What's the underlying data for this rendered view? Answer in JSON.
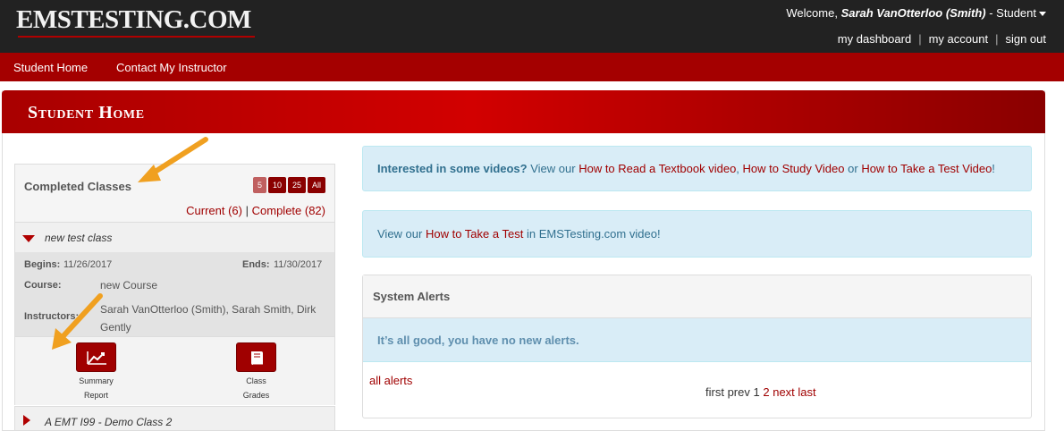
{
  "header": {
    "logo": "EMSTESTING.COM",
    "welcome_prefix": "Welcome,",
    "user_name": "Sarah VanOtterloo (Smith)",
    "role_label": "- Student",
    "links": [
      "my dashboard",
      "my account",
      "sign out"
    ],
    "link_separator": "|"
  },
  "nav": {
    "items": [
      "Student Home",
      "Contact My Instructor"
    ]
  },
  "page": {
    "title": "Student Home"
  },
  "completed_classes": {
    "title": "Completed Classes",
    "page_sizes": [
      "5",
      "10",
      "25",
      "All"
    ],
    "active_page_size": "5",
    "filter_current": "Current (6)",
    "filter_separator": "|",
    "filter_complete": "Complete (82)",
    "classes": [
      {
        "name": "new test class",
        "begins_label": "Begins:",
        "begins": "11/26/2017",
        "ends_label": "Ends:",
        "ends": "11/30/2017",
        "course_label": "Course:",
        "course": "new Course",
        "instructors_label": "Instructors:",
        "instructors": "Sarah VanOtterloo (Smith), Sarah Smith, Dirk Gently",
        "actions": [
          {
            "line1": "Summary",
            "line2": "Report",
            "icon": "chart-line-icon"
          },
          {
            "line1": "Class",
            "line2": "Grades",
            "icon": "book-icon"
          }
        ]
      },
      {
        "name": "A EMT I99 - Demo Class 2"
      }
    ]
  },
  "videos_box": {
    "lead": "Interested in some videos?",
    "view_our": "View our",
    "link1": "How to Read a Textbook video",
    "comma": ",",
    "link2": "How to Study Video",
    "or": "or",
    "link3": "How to Take a Test Video",
    "end": "!"
  },
  "video_box2": {
    "view_our": "View our",
    "link": "How to Take a Test",
    "in_text": "in",
    "site_link": "EMSTesting.com video",
    "end": "!"
  },
  "system_alerts": {
    "title": "System Alerts",
    "message": "It’s all good, you have no new alerts.",
    "all_alerts_link": "all alerts",
    "pager": {
      "first": "first",
      "prev": "prev",
      "page1": "1",
      "page2": "2",
      "next": "next",
      "last": "last"
    }
  },
  "colors": {
    "brand_red": "#a40000",
    "top_bar": "#222222",
    "info_bg": "#d9edf7",
    "annotation_arrow": "#f0a020"
  }
}
